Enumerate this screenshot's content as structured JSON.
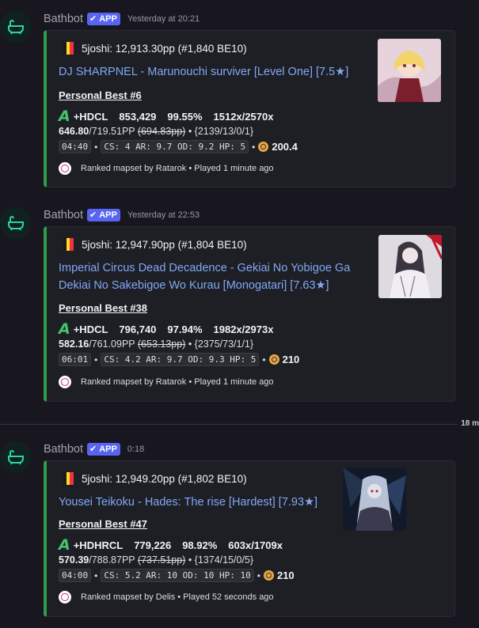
{
  "messages": [
    {
      "bot_name": "Bathbot",
      "badge": "APP",
      "timestamp": "Yesterday at 20:21",
      "author": "5joshi: 12,913.30pp (#1,840 BE10)",
      "title": "DJ SHARPNEL - Marunouchi surviver [Level One] [7.5★]",
      "personal_best": "Personal Best #6",
      "grade": "A",
      "mods": "+HDCL",
      "score": "853,429",
      "accuracy": "99.55%",
      "combo": "1512x/2570x",
      "pp": "646.80",
      "pp_max": "/719.51PP",
      "pp_fc": "(694.83pp)",
      "hits": "• {2139/13/0/1}",
      "length": "04:40",
      "map_stats": "CS: 4 AR: 9.7 OD: 9.2 HP: 5",
      "bpm": "200.4",
      "footer": "Ranked mapset by Ratarok • Played 1 minute ago"
    },
    {
      "bot_name": "Bathbot",
      "badge": "APP",
      "timestamp": "Yesterday at 22:53",
      "author": "5joshi: 12,947.90pp (#1,804 BE10)",
      "title": "Imperial Circus Dead Decadence - Gekiai No Yobigoe Ga Dekiai No Sakebigoe Wo Kurau [Monogatari] [7.63★]",
      "personal_best": "Personal Best #38",
      "grade": "A",
      "mods": "+HDCL",
      "score": "796,740",
      "accuracy": "97.94%",
      "combo": "1982x/2973x",
      "pp": "582.16",
      "pp_max": "/761.09PP",
      "pp_fc": "(653.13pp)",
      "hits": "• {2375/73/1/1}",
      "length": "06:01",
      "map_stats": "CS: 4.2 AR: 9.7 OD: 9.3 HP: 5",
      "bpm": "210",
      "footer": "Ranked mapset by Ratarok • Played 1 minute ago"
    },
    {
      "bot_name": "Bathbot",
      "badge": "APP",
      "timestamp": "0:18",
      "author": "5joshi: 12,949.20pp (#1,802 BE10)",
      "title": "Yousei Teikoku - Hades: The rise [Hardest] [7.93★]",
      "personal_best": "Personal Best #47",
      "grade": "A",
      "mods": "+HDHRCL",
      "score": "779,226",
      "accuracy": "98.92%",
      "combo": "603x/1709x",
      "pp": "570.39",
      "pp_max": "/788.87PP",
      "pp_fc": "(737.51pp)",
      "hits": "• {1374/15/0/5}",
      "length": "04:00",
      "map_stats": "CS: 5.2 AR: 10 OD: 10 HP: 10",
      "bpm": "210",
      "footer": "Ranked mapset by Delis • Played 52 seconds ago"
    }
  ],
  "divider_label": "18 m",
  "colors": {
    "embed_accent": "#2e9d4a",
    "link": "#7fa8f5",
    "badge": "#5865f2",
    "grade_a": "#45c46b"
  },
  "icons": {
    "avatar": "bathtub-icon",
    "badge_check": "checkmark-icon",
    "author_flag": "belgium-flag-icon",
    "bpm": "osu-bpm-icon",
    "footer": "osu-ranked-icon"
  }
}
